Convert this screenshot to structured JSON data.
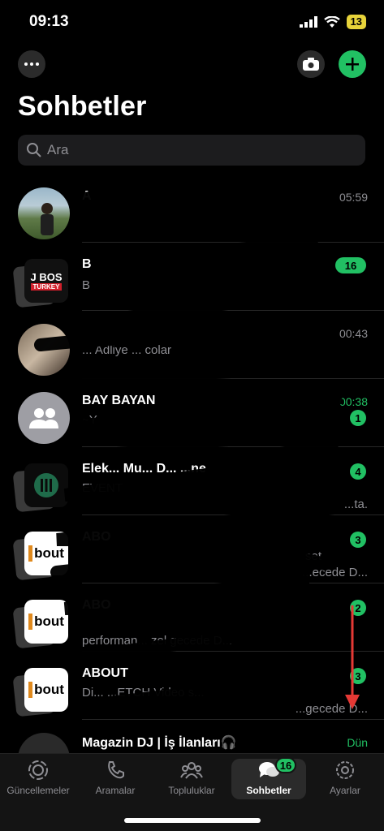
{
  "status": {
    "time": "09:13",
    "battery": "13"
  },
  "header": {
    "title": "Sohbetler"
  },
  "search": {
    "placeholder": "Ara"
  },
  "chats": [
    {
      "name": "A",
      "time": "05:59",
      "time_unread": false,
      "badge": "",
      "preview": ""
    },
    {
      "name": "B",
      "time": "",
      "time_unread": false,
      "badge": "16",
      "preview": "B"
    },
    {
      "name": "",
      "time": "00:43",
      "time_unread": false,
      "badge": "",
      "preview": "... Adliye ... colar"
    },
    {
      "name": "BAY BAYAN",
      "time": "00:38",
      "time_unread": true,
      "badge": "1",
      "preview": "~Y"
    },
    {
      "name": "Elek... Mu... D... ...ne",
      "time": "",
      "time_unread": false,
      "badge": "4",
      "preview": "EVENT"
    },
    {
      "name": "ABO",
      "time": "",
      "time_unread": false,
      "badge": "3",
      "preview": "set"
    },
    {
      "name": "ABO",
      "time": "",
      "time_unread": false,
      "badge": "2",
      "preview": "performan... zel gecede D..."
    },
    {
      "name": "ABOUT",
      "time": "",
      "time_unread": false,
      "badge": "3",
      "preview": "Di... ...ETCH Video s..."
    },
    {
      "name": "Magazin DJ | İş İlanları🎧",
      "time": "Dün",
      "time_unread": true,
      "badge": "",
      "preview": ""
    }
  ],
  "chat_preview_extra": {
    "row5_line2": "...ta.",
    "row6_line2": "...ecede D...",
    "row8_line2": "...gecede D..."
  },
  "tabs": [
    {
      "label": "Güncellemeler",
      "icon": "updates-icon"
    },
    {
      "label": "Aramalar",
      "icon": "phone-icon"
    },
    {
      "label": "Topluluklar",
      "icon": "communities-icon"
    },
    {
      "label": "Sohbetler",
      "icon": "chats-icon",
      "badge": "16"
    },
    {
      "label": "Ayarlar",
      "icon": "settings-icon"
    }
  ],
  "colors": {
    "accent": "#21c063",
    "background": "#000000",
    "annotation_arrow": "#e53935"
  }
}
